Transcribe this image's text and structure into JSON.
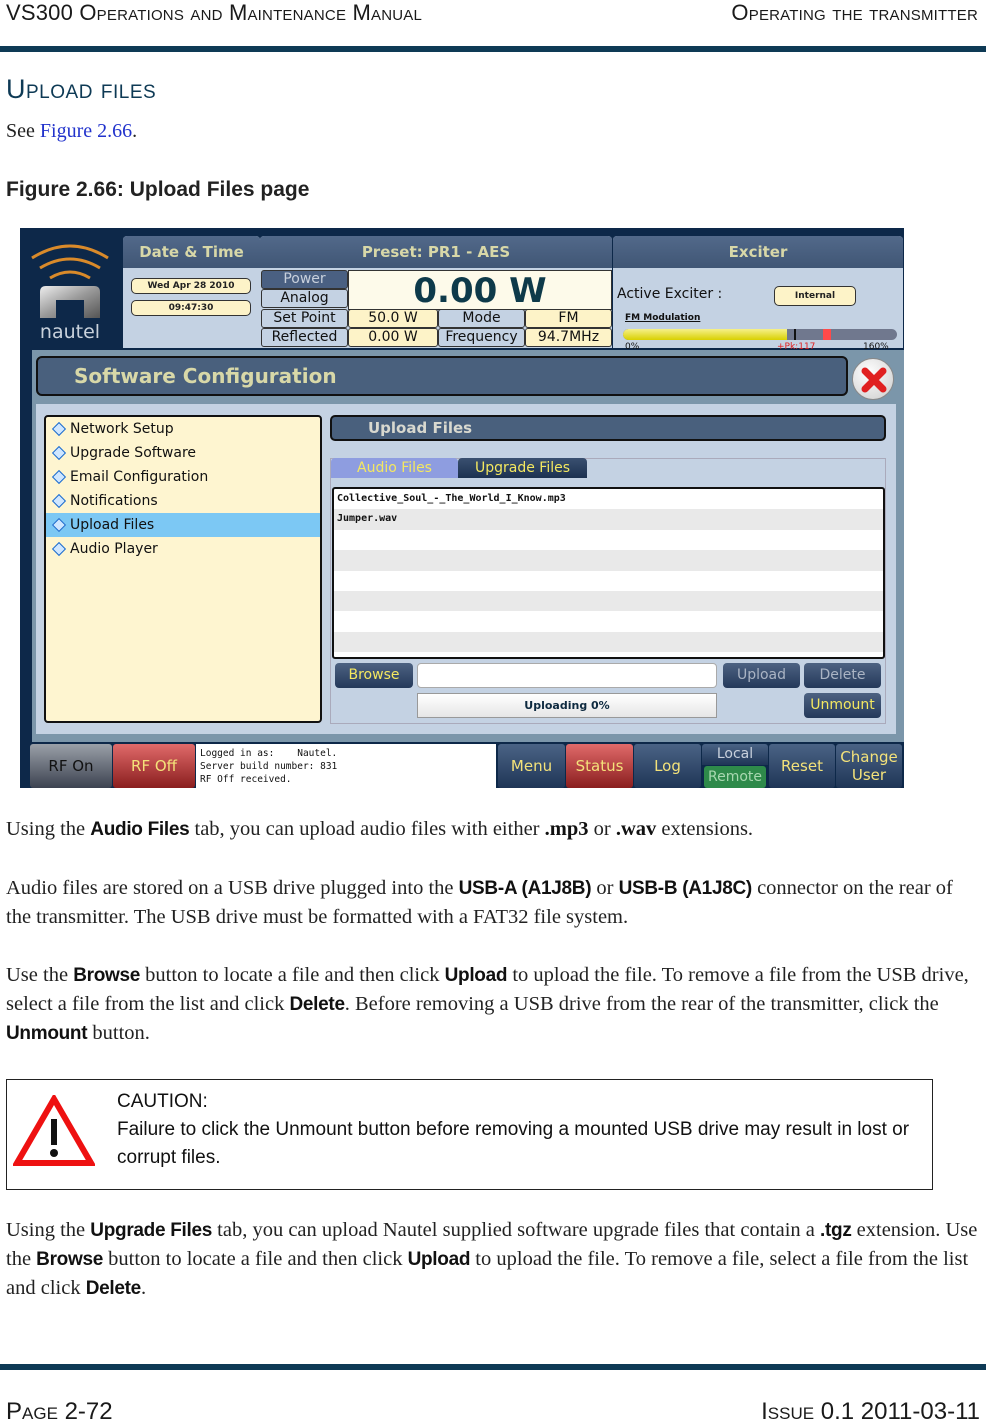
{
  "header": {
    "left": "VS300 Operations and Maintenance Manual",
    "right": "Operating the transmitter"
  },
  "section": {
    "title": "Upload files",
    "see_prefix": "See ",
    "see_link": "Figure 2.66",
    "see_suffix": "."
  },
  "figure": {
    "caption": "Figure 2.66: Upload Files page"
  },
  "ui": {
    "logo_text": "nautel",
    "date_time": {
      "title": "Date & Time",
      "date": "Wed Apr 28 2010",
      "time": "09:47:30"
    },
    "preset": {
      "title": "Preset: PR1 - AES",
      "power_label": "Power",
      "analog_label": "Analog",
      "power_value": "0.00 W",
      "set_point_label": "Set Point",
      "set_point_value": "50.0 W",
      "mode_label": "Mode",
      "mode_value": "FM",
      "reflected_label": "Reflected",
      "reflected_value": "0.00 W",
      "frequency_label": "Frequency",
      "frequency_value": "94.7MHz"
    },
    "exciter": {
      "title": "Exciter",
      "active_label": "Active Exciter :",
      "active_value": "Internal",
      "modulation_label": "FM Modulation",
      "scale_min": "0%",
      "peak_label": "+Pk:117",
      "scale_max": "160%",
      "modulation_fill_percent": 96,
      "peak_percent": 117
    },
    "config_title": "Software Configuration",
    "menu_items": [
      {
        "label": "Network Setup",
        "selected": false
      },
      {
        "label": "Upgrade Software",
        "selected": false
      },
      {
        "label": "Email Configuration",
        "selected": false
      },
      {
        "label": "Notifications",
        "selected": false
      },
      {
        "label": "Upload Files",
        "selected": true
      },
      {
        "label": "Audio Player",
        "selected": false
      }
    ],
    "panel_title": "Upload Files",
    "tabs": [
      {
        "label": "Audio Files",
        "active": true
      },
      {
        "label": "Upgrade Files",
        "active": false
      }
    ],
    "files": [
      "Collective_Soul_-_The_World_I_Know.mp3",
      "Jumper.wav",
      "",
      "",
      "",
      "",
      "",
      ""
    ],
    "buttons": {
      "browse": "Browse",
      "upload": "Upload",
      "delete": "Delete",
      "unmount": "Unmount"
    },
    "path_input_value": "",
    "progress_text": "Uploading 0%",
    "bottom_bar": {
      "rf_on": "RF On",
      "rf_off": "RF Off",
      "log_lines": [
        "Logged in as:    Nautel.",
        "Server build number: 831",
        "RF Off received."
      ],
      "menu": "Menu",
      "status": "Status",
      "log": "Log",
      "local": "Local",
      "remote": "Remote",
      "reset": "Reset",
      "change_user": "Change User"
    }
  },
  "body": {
    "p1": {
      "a": "Using the ",
      "b": "Audio Files",
      "c": " tab, you can upload audio files with either ",
      "d": ".mp3",
      "e": " or ",
      "f": ".wav",
      "g": " extensions."
    },
    "p2": {
      "a": "Audio files are stored on a USB drive plugged into the ",
      "b": "USB-A (A1J8B)",
      "c": " or ",
      "d": "USB-B (A1J8C)",
      "e": " connector on the rear of the transmitter. The USB drive must be formatted with a FAT32 file system."
    },
    "p3": {
      "a": "Use the ",
      "b": "Browse",
      "c": " button to locate a file and then click ",
      "d": "Upload",
      "e": " to upload the file. To remove a file from the USB drive, select a file from the list and click ",
      "f": "Delete",
      "g": ". Before removing a USB drive from the rear of the transmitter, click the ",
      "h": "Unmount",
      "i": " button."
    },
    "caution": {
      "title": "CAUTION:",
      "text": "Failure to click the Unmount button before removing a mounted USB drive may result in lost or corrupt files."
    },
    "p4": {
      "a": "Using the ",
      "b": "Upgrade Files",
      "c": " tab, you can upload Nautel supplied software upgrade files that contain a ",
      "d": ".tgz",
      "e": " extension. Use the ",
      "f": "Browse",
      "g": " button to locate a file and then click ",
      "h": "Upload",
      "i": " to upload the file. To remove a file, select a file from the list and click ",
      "j": "Delete",
      "k": "."
    }
  },
  "footer": {
    "left": "Page 2-72",
    "right": "Issue 0.1  2011-03-11"
  }
}
